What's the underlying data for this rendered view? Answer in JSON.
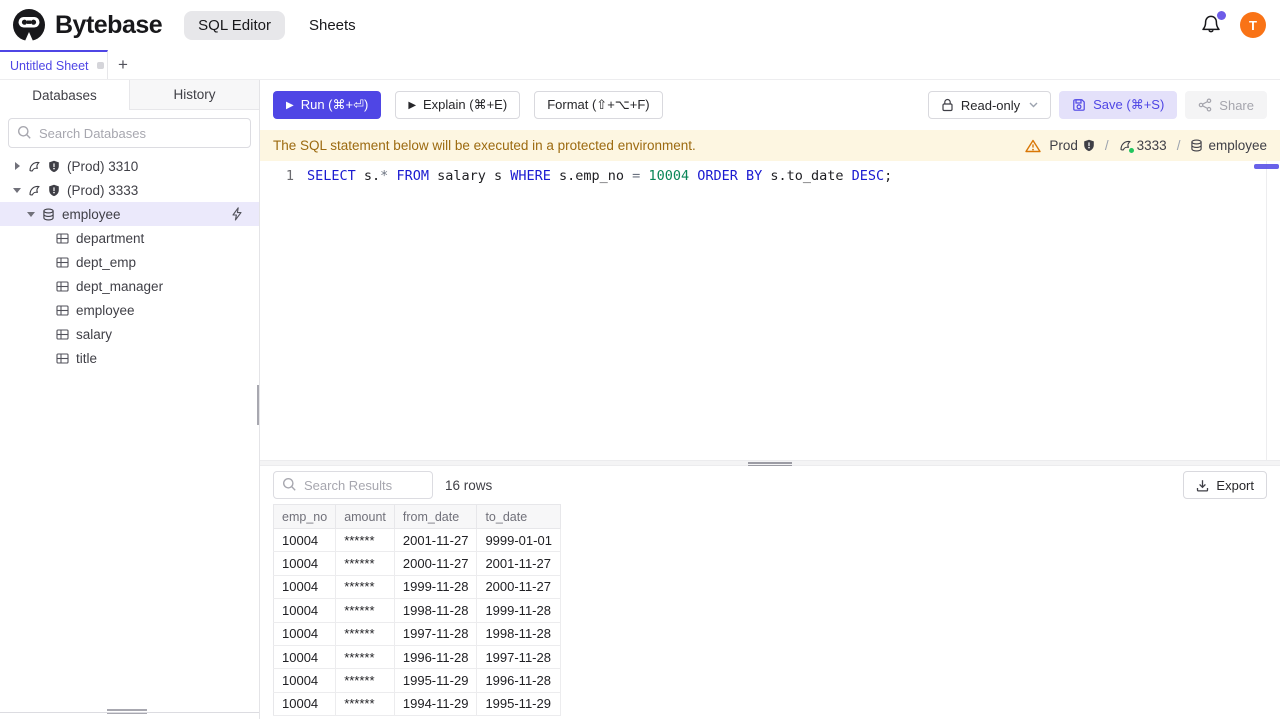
{
  "colors": {
    "accent": "#4f46e5",
    "accent_light_bg": "#e4e1fa",
    "banner_bg": "#fdf6e1",
    "banner_text": "#9c6a10",
    "warning_icon": "#d97706",
    "avatar_bg": "#f97316",
    "sql_keyword": "#1a1ad1",
    "sql_number": "#098658",
    "status_green": "#22c55e"
  },
  "header": {
    "brand": "Bytebase",
    "nav": [
      {
        "label": "SQL Editor",
        "active": true
      },
      {
        "label": "Sheets",
        "active": false
      }
    ],
    "avatar_initial": "T"
  },
  "sheetbar": {
    "sheet_title": "Untitled Sheet",
    "add_label": "+"
  },
  "sidebar": {
    "tabs": [
      {
        "label": "Databases",
        "active": true
      },
      {
        "label": "History",
        "active": false
      }
    ],
    "search_placeholder": "Search Databases",
    "tree": {
      "instances": [
        {
          "label": "(Prod) 3310",
          "expanded": false
        },
        {
          "label": "(Prod) 3333",
          "expanded": true
        }
      ],
      "database": {
        "label": "employee",
        "selected": true
      },
      "tables": [
        "department",
        "dept_emp",
        "dept_manager",
        "employee",
        "salary",
        "title"
      ]
    }
  },
  "toolbar": {
    "run_label": "Run (⌘+⏎)",
    "explain_label": "Explain (⌘+E)",
    "format_label": "Format (⇧+⌥+F)",
    "readonly_label": "Read-only",
    "save_label": "Save (⌘+S)",
    "share_label": "Share"
  },
  "banner": {
    "message": "The SQL statement below will be executed in a protected environment.",
    "environment": "Prod",
    "instance": "3333",
    "database": "employee",
    "separator": "/"
  },
  "editor": {
    "line_number": "1",
    "sql_text": "SELECT s.* FROM salary s WHERE s.emp_no = 10004 ORDER BY s.to_date DESC;",
    "tokens": [
      {
        "text": "SELECT",
        "type": "kw"
      },
      {
        "text": " s.",
        "type": "plain"
      },
      {
        "text": "*",
        "type": "op"
      },
      {
        "text": " ",
        "type": "plain"
      },
      {
        "text": "FROM",
        "type": "kw"
      },
      {
        "text": " salary s ",
        "type": "plain"
      },
      {
        "text": "WHERE",
        "type": "kw"
      },
      {
        "text": " s.emp_no ",
        "type": "plain"
      },
      {
        "text": "= ",
        "type": "op"
      },
      {
        "text": "10004",
        "type": "num"
      },
      {
        "text": " ",
        "type": "plain"
      },
      {
        "text": "ORDER BY",
        "type": "kw"
      },
      {
        "text": " s.to_date ",
        "type": "plain"
      },
      {
        "text": "DESC",
        "type": "kw"
      },
      {
        "text": ";",
        "type": "plain"
      }
    ]
  },
  "results": {
    "search_placeholder": "Search Results",
    "row_count_label": "16 rows",
    "export_label": "Export",
    "table": {
      "columns": [
        "emp_no",
        "amount",
        "from_date",
        "to_date"
      ],
      "rows": [
        [
          "10004",
          "******",
          "2001-11-27",
          "9999-01-01"
        ],
        [
          "10004",
          "******",
          "2000-11-27",
          "2001-11-27"
        ],
        [
          "10004",
          "******",
          "1999-11-28",
          "2000-11-27"
        ],
        [
          "10004",
          "******",
          "1998-11-28",
          "1999-11-28"
        ],
        [
          "10004",
          "******",
          "1997-11-28",
          "1998-11-28"
        ],
        [
          "10004",
          "******",
          "1996-11-28",
          "1997-11-28"
        ],
        [
          "10004",
          "******",
          "1995-11-29",
          "1996-11-28"
        ],
        [
          "10004",
          "******",
          "1994-11-29",
          "1995-11-29"
        ]
      ]
    }
  }
}
